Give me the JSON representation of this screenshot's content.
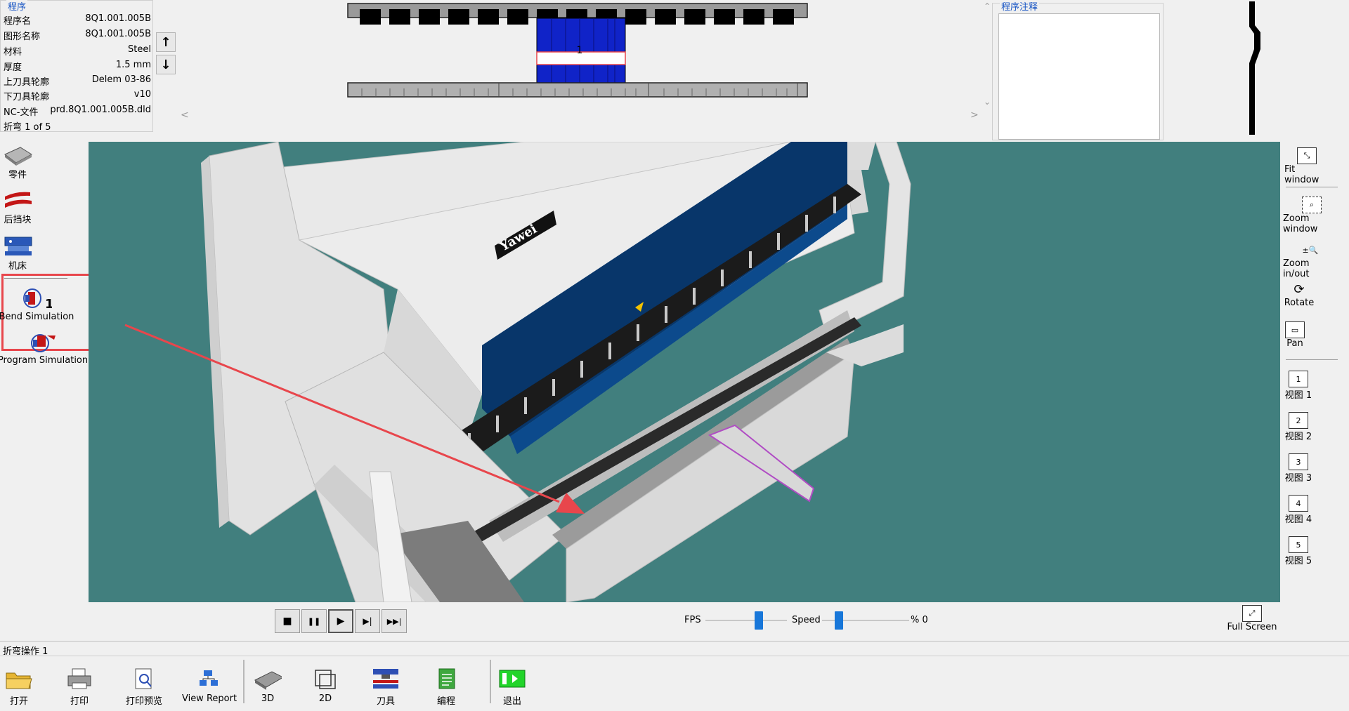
{
  "program": {
    "legend": "程序",
    "rows": [
      {
        "key": "程序名",
        "value": "8Q1.001.005B"
      },
      {
        "key": "图形名称",
        "value": "8Q1.001.005B"
      },
      {
        "key": "材料",
        "value": "Steel"
      },
      {
        "key": "厚度",
        "value": "1.5 mm"
      },
      {
        "key": "上刀具轮廓",
        "value": "Delem 03-86"
      },
      {
        "key": "下刀具轮廓",
        "value": "v10"
      },
      {
        "key": "NC-文件",
        "value": "prd.8Q1.001.005B.dld"
      }
    ],
    "bend_status": "折弯 1 of 5",
    "up_icon": "↑",
    "down_icon": "↓"
  },
  "tooling_view": {
    "bend_number": "1",
    "scroll_left": "<",
    "scroll_right": ">"
  },
  "notes": {
    "legend": "程序注释",
    "value": ""
  },
  "left_toolbar": {
    "items": [
      {
        "label": "零件",
        "icon": "part-icon"
      },
      {
        "label": "后挡块",
        "icon": "backgauge-icon"
      },
      {
        "label": "机床",
        "icon": "machine-icon"
      },
      {
        "label": "Bend Simulation",
        "icon": "bend-simulation-icon"
      },
      {
        "label": "Program Simulation",
        "icon": "program-simulation-icon"
      }
    ]
  },
  "viewport": {
    "machine_brand": "Yawei"
  },
  "right_toolbar": {
    "items": [
      {
        "label": "Fit window",
        "icon": "fit-window-icon"
      },
      {
        "label": "Zoom window",
        "icon": "zoom-window-icon"
      },
      {
        "label": "Zoom in/out",
        "icon": "zoom-in-out-icon",
        "glyph": "±🔍"
      },
      {
        "label": "Rotate",
        "icon": "rotate-icon"
      },
      {
        "label": "Pan",
        "icon": "pan-icon"
      },
      {
        "label": "视图 1",
        "icon": "view-1-icon",
        "glyph": "1"
      },
      {
        "label": "视图 2",
        "icon": "view-2-icon",
        "glyph": "2"
      },
      {
        "label": "视图 3",
        "icon": "view-3-icon",
        "glyph": "3"
      },
      {
        "label": "视图 4",
        "icon": "view-4-icon",
        "glyph": "4"
      },
      {
        "label": "视图 5",
        "icon": "view-5-icon",
        "glyph": "5"
      }
    ]
  },
  "playback": {
    "stop": "■",
    "pause": "❚❚",
    "play": "▶",
    "step": "▶|",
    "end": "▶▶|",
    "fps_label": "FPS",
    "speed_label": "Speed",
    "percent_label": "% 0",
    "fps_level": 0.62,
    "speed_level": 0.2
  },
  "full_screen": {
    "label": "Full Screen",
    "icon": "full-screen-icon"
  },
  "status_bar": {
    "text": "折弯操作 1"
  },
  "bottom_toolbar": {
    "items": [
      {
        "label": "打开",
        "icon": "open-folder-icon"
      },
      {
        "label": "打印",
        "icon": "print-icon"
      },
      {
        "label": "打印预览",
        "icon": "print-preview-icon"
      },
      {
        "label": "View Report",
        "icon": "view-report-icon"
      },
      {
        "label": "3D",
        "icon": "3d-view-icon"
      },
      {
        "label": "2D",
        "icon": "2d-view-icon"
      },
      {
        "label": "刀具",
        "icon": "tools-icon"
      },
      {
        "label": "编程",
        "icon": "programming-icon"
      },
      {
        "label": "退出",
        "icon": "exit-icon"
      }
    ]
  },
  "colors": {
    "viewport_bg": "#417f7e",
    "highlight_red": "#e8464c",
    "accent_blue": "#1a56c4",
    "tool_blue": "#1023c8"
  }
}
